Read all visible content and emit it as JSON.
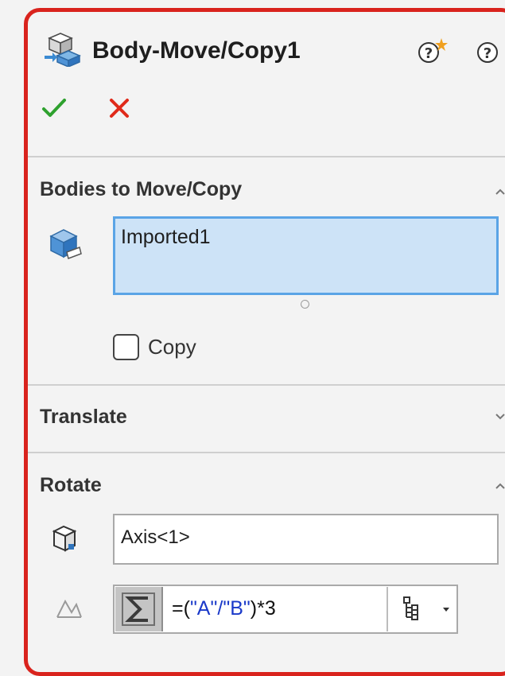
{
  "header": {
    "title": "Body-Move/Copy1",
    "icons": [
      "body-move-copy-icon",
      "whats-new-help-icon",
      "help-icon"
    ]
  },
  "actions": {
    "ok_icon": "checkmark-icon",
    "cancel_icon": "x-icon",
    "ok_color": "#2ea12e",
    "cancel_color": "#e02a1a"
  },
  "bodies_section": {
    "title": "Bodies to Move/Copy",
    "selection_value": "Imported1",
    "copy_label": "Copy",
    "copy_checked": false
  },
  "translate_section": {
    "title": "Translate"
  },
  "rotate_section": {
    "title": "Rotate",
    "axis_value": "Axis<1>",
    "equation": {
      "prefix": "=(",
      "a": "\"A\"",
      "op": "/",
      "b": "\"B\"",
      "suffix": ")*3"
    }
  },
  "colors": {
    "frame_border": "#d9231d",
    "selection_bg": "#cde3f7",
    "selection_border": "#5aa4e6"
  }
}
